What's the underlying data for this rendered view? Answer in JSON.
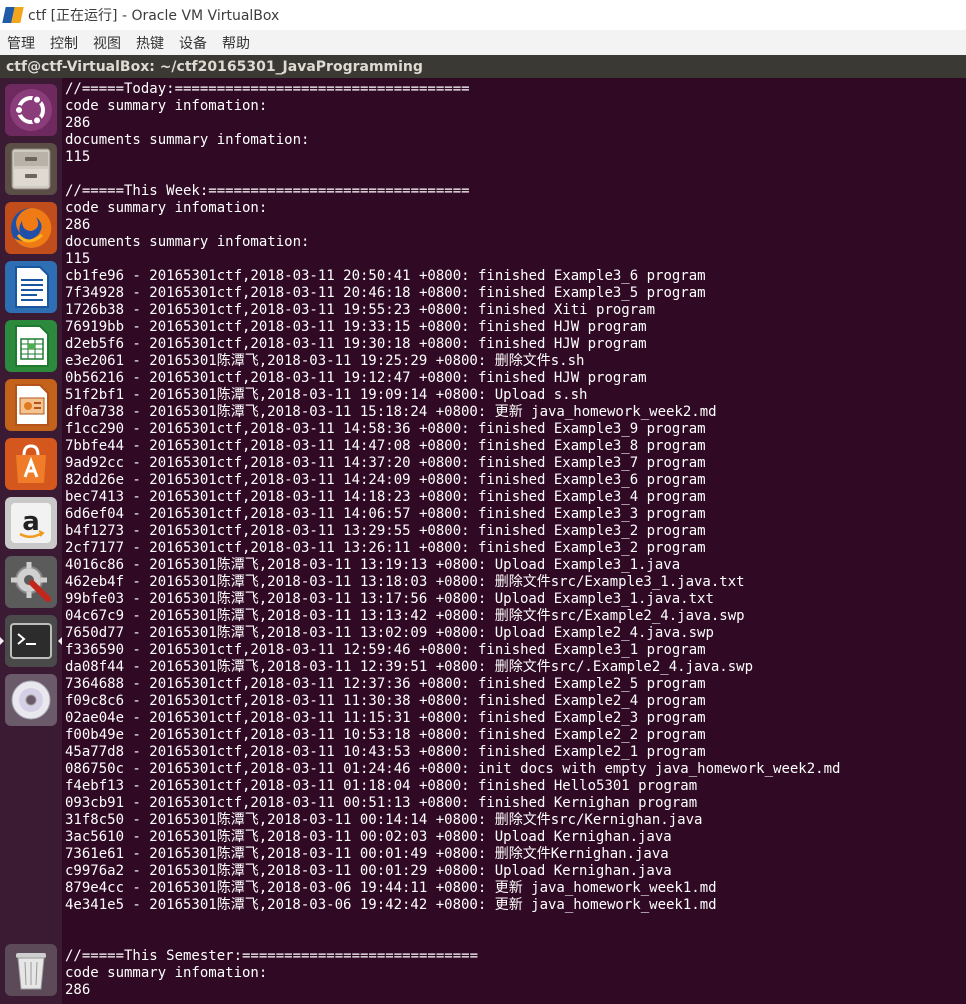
{
  "window": {
    "title": "ctf [正在运行] - Oracle VM VirtualBox"
  },
  "menu": [
    "管理",
    "控制",
    "视图",
    "热键",
    "设备",
    "帮助"
  ],
  "terminal": {
    "title": "ctf@ctf-VirtualBox: ~/ctf20165301_JavaProgramming",
    "lines": [
      "//=====Today:===================================",
      "code summary infomation:",
      "286",
      "documents summary infomation:",
      "115",
      "",
      "//=====This Week:===============================",
      "code summary infomation:",
      "286",
      "documents summary infomation:",
      "115",
      "cb1fe96 - 20165301ctf,2018-03-11 20:50:41 +0800: finished Example3_6 program",
      "7f34928 - 20165301ctf,2018-03-11 20:46:18 +0800: finished Example3_5 program",
      "1726b38 - 20165301ctf,2018-03-11 19:55:23 +0800: finished Xiti program",
      "76919bb - 20165301ctf,2018-03-11 19:33:15 +0800: finished HJW program",
      "d2eb5f6 - 20165301ctf,2018-03-11 19:30:18 +0800: finished HJW program",
      "e3e2061 - 20165301陈潭飞,2018-03-11 19:25:29 +0800: 删除文件s.sh",
      "0b56216 - 20165301ctf,2018-03-11 19:12:47 +0800: finished HJW program",
      "51f2bf1 - 20165301陈潭飞,2018-03-11 19:09:14 +0800: Upload s.sh",
      "df0a738 - 20165301陈潭飞,2018-03-11 15:18:24 +0800: 更新 java_homework_week2.md",
      "f1cc290 - 20165301ctf,2018-03-11 14:58:36 +0800: finished Example3_9 program",
      "7bbfe44 - 20165301ctf,2018-03-11 14:47:08 +0800: finished Example3_8 program",
      "9ad92cc - 20165301ctf,2018-03-11 14:37:20 +0800: finished Example3_7 program",
      "82dd26e - 20165301ctf,2018-03-11 14:24:09 +0800: finished Example3_6 program",
      "bec7413 - 20165301ctf,2018-03-11 14:18:23 +0800: finished Example3_4 program",
      "6d6ef04 - 20165301ctf,2018-03-11 14:06:57 +0800: finished Example3_3 program",
      "b4f1273 - 20165301ctf,2018-03-11 13:29:55 +0800: finished Example3_2 program",
      "2cf7177 - 20165301ctf,2018-03-11 13:26:11 +0800: finished Example3_2 program",
      "4016c86 - 20165301陈潭飞,2018-03-11 13:19:13 +0800: Upload Example3_1.java",
      "462eb4f - 20165301陈潭飞,2018-03-11 13:18:03 +0800: 删除文件src/Example3_1.java.txt",
      "99bfe03 - 20165301陈潭飞,2018-03-11 13:17:56 +0800: Upload Example3_1.java.txt",
      "04c67c9 - 20165301陈潭飞,2018-03-11 13:13:42 +0800: 删除文件src/Example2_4.java.swp",
      "7650d77 - 20165301陈潭飞,2018-03-11 13:02:09 +0800: Upload Example2_4.java.swp",
      "f336590 - 20165301ctf,2018-03-11 12:59:46 +0800: finished Example3_1 program",
      "da08f44 - 20165301陈潭飞,2018-03-11 12:39:51 +0800: 删除文件src/.Example2_4.java.swp",
      "7364688 - 20165301ctf,2018-03-11 12:37:36 +0800: finished Example2_5 program",
      "f09c8c6 - 20165301ctf,2018-03-11 11:30:38 +0800: finished Example2_4 program",
      "02ae04e - 20165301ctf,2018-03-11 11:15:31 +0800: finished Example2_3 program",
      "f00b49e - 20165301ctf,2018-03-11 10:53:18 +0800: finished Example2_2 program",
      "45a77d8 - 20165301ctf,2018-03-11 10:43:53 +0800: finished Example2_1 program",
      "086750c - 20165301ctf,2018-03-11 01:24:46 +0800: init docs with empty java_homework_week2.md",
      "f4ebf13 - 20165301ctf,2018-03-11 01:18:04 +0800: finished Hello5301 program",
      "093cb91 - 20165301ctf,2018-03-11 00:51:13 +0800: finished Kernighan program",
      "31f8c50 - 20165301陈潭飞,2018-03-11 00:14:14 +0800: 删除文件src/Kernighan.java",
      "3ac5610 - 20165301陈潭飞,2018-03-11 00:02:03 +0800: Upload Kernighan.java",
      "7361e61 - 20165301陈潭飞,2018-03-11 00:01:49 +0800: 删除文件Kernighan.java",
      "c9976a2 - 20165301陈潭飞,2018-03-11 00:01:29 +0800: Upload Kernighan.java",
      "879e4cc - 20165301陈潭飞,2018-03-06 19:44:11 +0800: 更新 java_homework_week1.md",
      "4e341e5 - 20165301陈潭飞,2018-03-06 19:42:42 +0800: 更新 java_homework_week1.md",
      "",
      "",
      "//=====This Semester:============================",
      "code summary infomation:",
      "286"
    ]
  },
  "launcher": [
    {
      "name": "ubuntu-dash-icon"
    },
    {
      "name": "files-icon"
    },
    {
      "name": "firefox-icon"
    },
    {
      "name": "libreoffice-writer-icon"
    },
    {
      "name": "libreoffice-calc-icon"
    },
    {
      "name": "libreoffice-impress-icon"
    },
    {
      "name": "software-center-icon"
    },
    {
      "name": "amazon-icon"
    },
    {
      "name": "system-settings-icon"
    },
    {
      "name": "terminal-icon"
    },
    {
      "name": "dvd-icon"
    },
    {
      "name": "trash-icon"
    }
  ],
  "colors": {
    "terminal_bg": "#300a24",
    "launcher_bg": "#3b1a33",
    "terminal_text": "#ffffff"
  }
}
